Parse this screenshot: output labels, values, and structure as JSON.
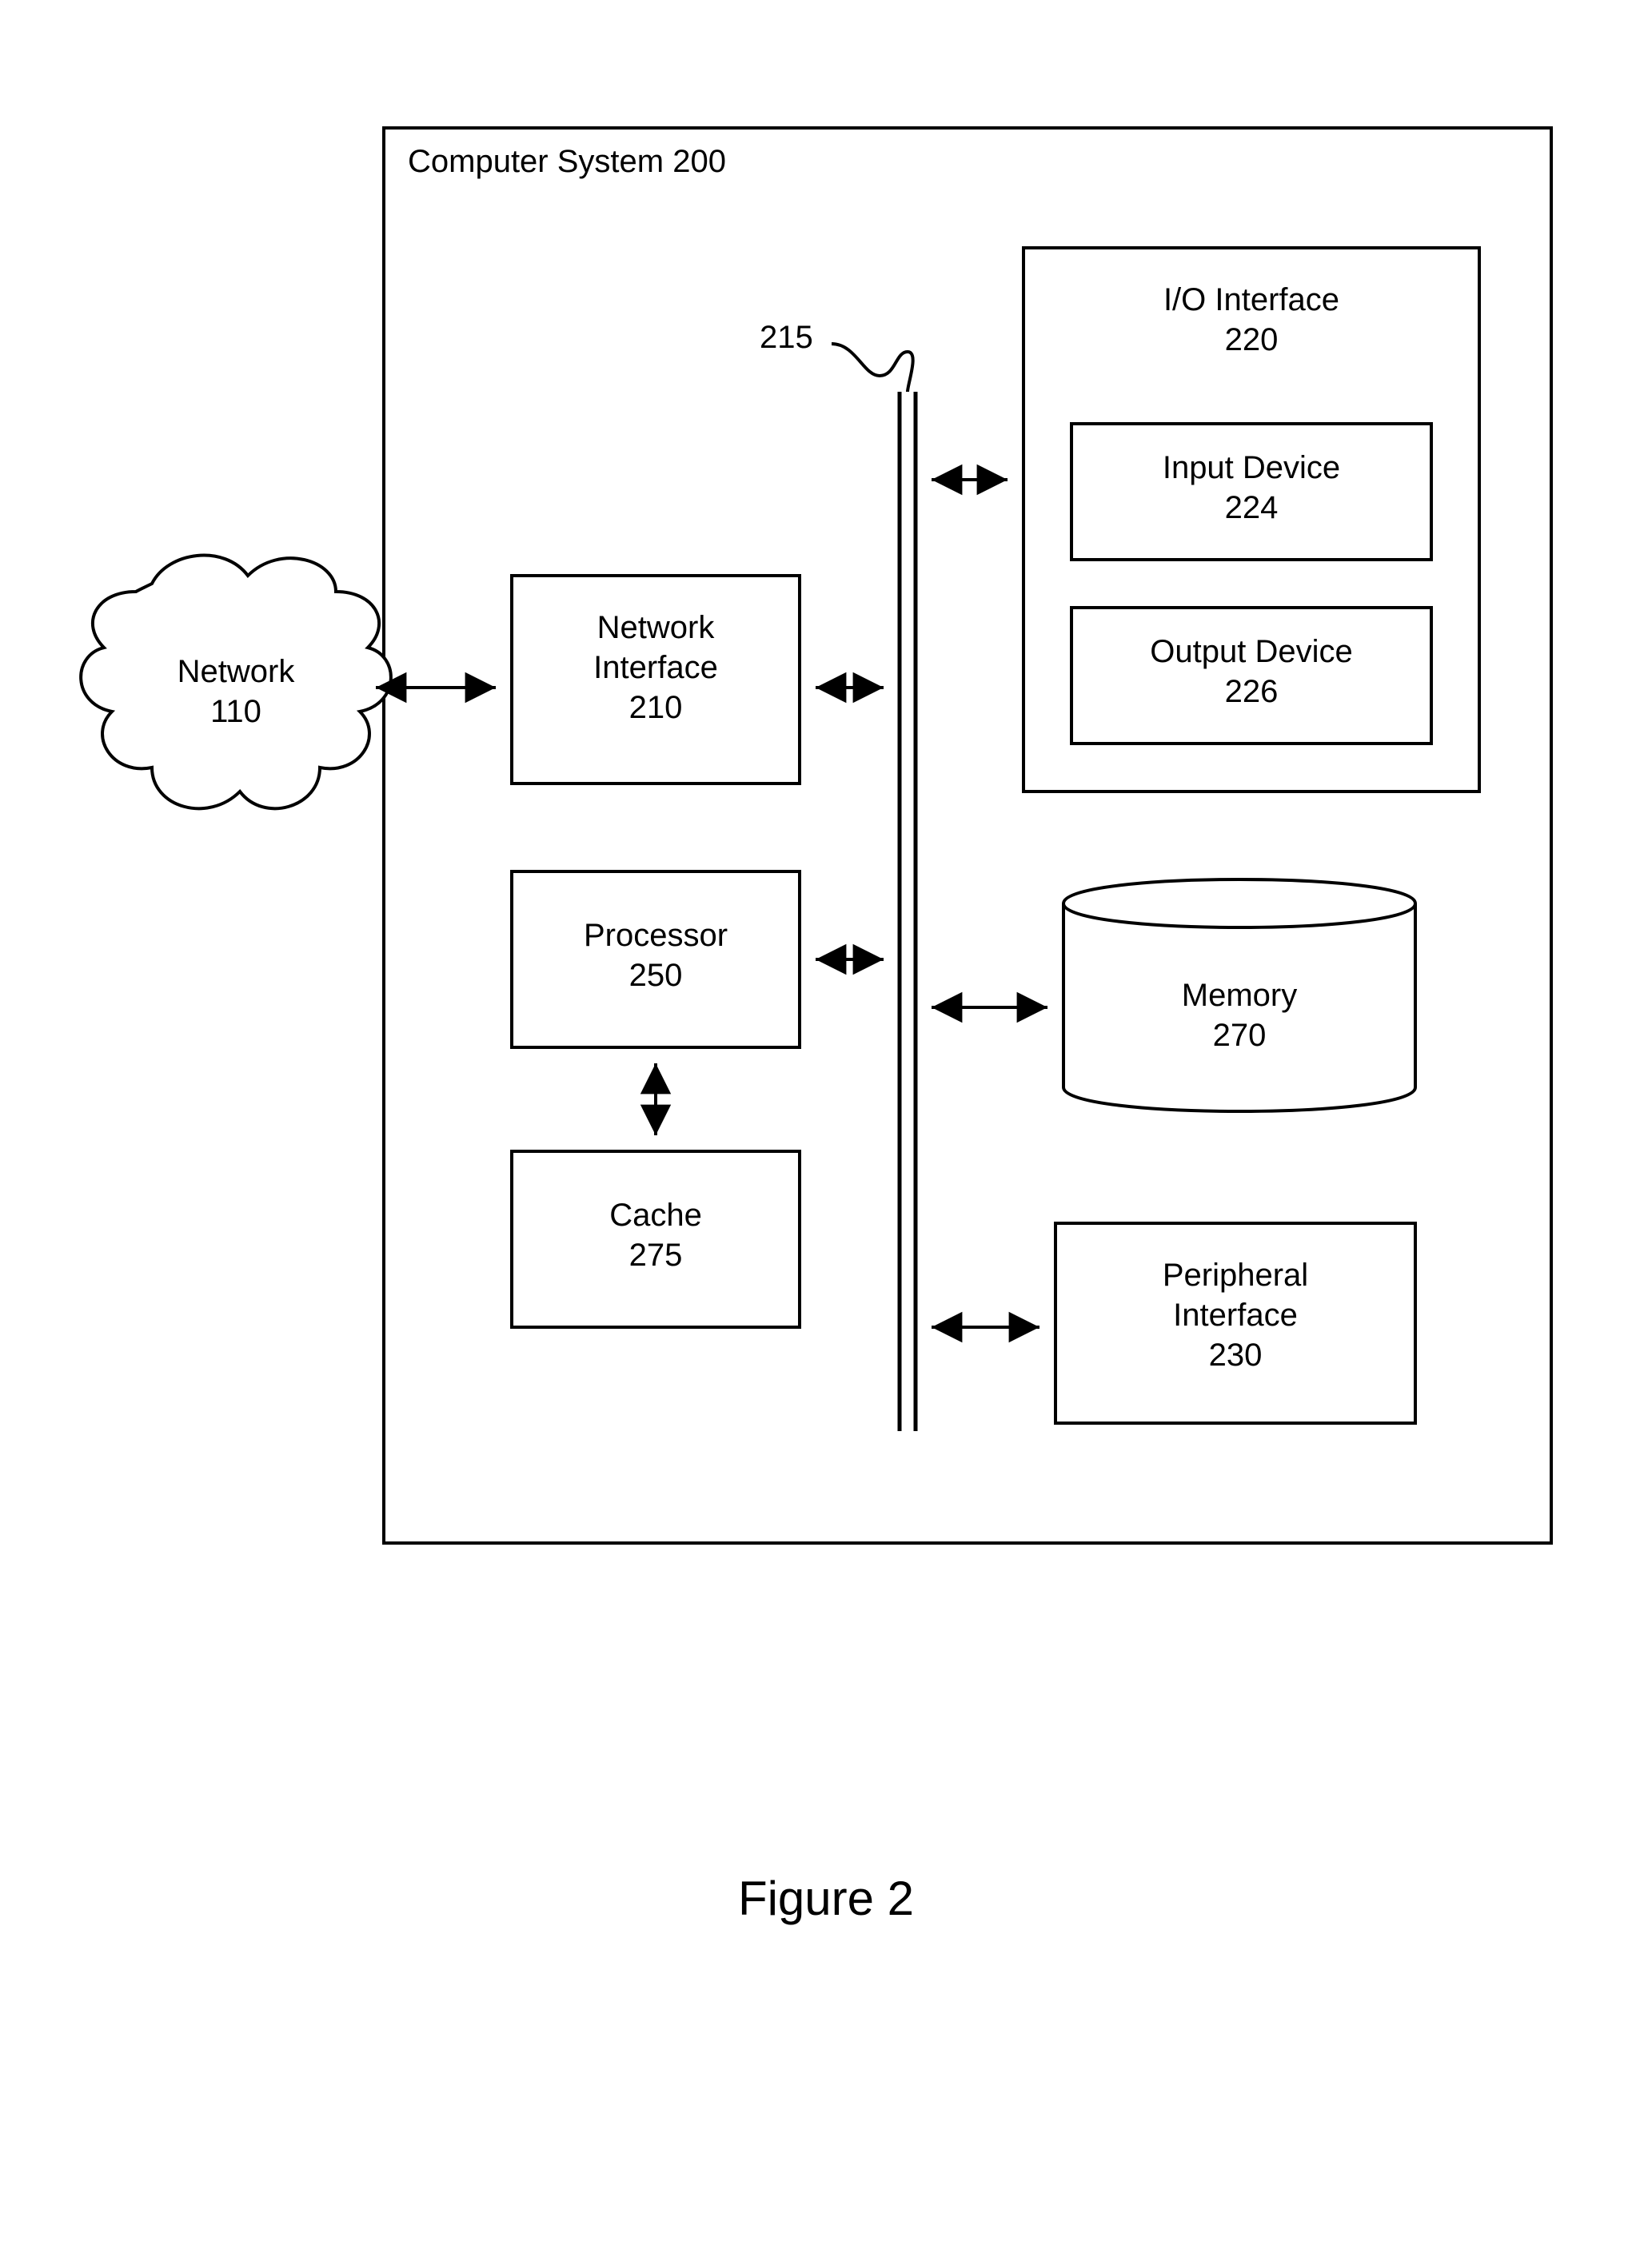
{
  "system": {
    "title": "Computer System 200"
  },
  "network": {
    "label": "Network",
    "ref": "110"
  },
  "network_interface": {
    "label": "Network\nInterface",
    "ref": "210"
  },
  "bus": {
    "ref": "215"
  },
  "io_interface": {
    "label": "I/O Interface",
    "ref": "220"
  },
  "input_device": {
    "label": "Input Device",
    "ref": "224"
  },
  "output_device": {
    "label": "Output Device",
    "ref": "226"
  },
  "processor": {
    "label": "Processor",
    "ref": "250"
  },
  "cache": {
    "label": "Cache",
    "ref": "275"
  },
  "memory": {
    "label": "Memory",
    "ref": "270"
  },
  "peripheral": {
    "label": "Peripheral\nInterface",
    "ref": "230"
  },
  "figure": {
    "caption": "Figure 2"
  }
}
